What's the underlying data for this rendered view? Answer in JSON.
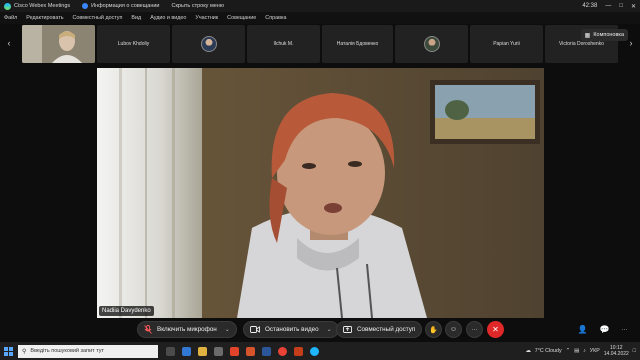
{
  "titlebar": {
    "app_title": "Cisco Webex Meetings",
    "meeting_info": "Информация о совещании",
    "hide_menu": "Скрыть строку меню",
    "clock": "42:38"
  },
  "menubar": {
    "items": [
      "Файл",
      "Редактировать",
      "Совместный доступ",
      "Вид",
      "Аудио и видео",
      "Участник",
      "Совещание",
      "Справка"
    ]
  },
  "participants": [
    {
      "name": "",
      "type": "video"
    },
    {
      "name": "Lubov Khdoliy",
      "type": "name"
    },
    {
      "name": "",
      "type": "avatar"
    },
    {
      "name": "Ilchuk M.",
      "type": "name"
    },
    {
      "name": "Наталія Бдовенко",
      "type": "name"
    },
    {
      "name": "",
      "type": "avatar"
    },
    {
      "name": "Papian Yurii",
      "type": "name"
    },
    {
      "name": "Victoria Doroshenko",
      "type": "name"
    }
  ],
  "layout_button": "Компоновка",
  "main_video": {
    "speaker_name": "Nadiia Davydenko"
  },
  "controls": {
    "mic": "Включить микрофон",
    "video": "Остановить видео",
    "share": "Совместный доступ",
    "more": "···"
  },
  "taskbar": {
    "search_placeholder": "Введіть пошуковий запит тут",
    "weather": "7°C Cloudy",
    "lang": "УКР",
    "time": "10:12",
    "date": "14.04.2022"
  },
  "colors": {
    "end_call": "#e02828",
    "accent": "#1fb6ff"
  }
}
